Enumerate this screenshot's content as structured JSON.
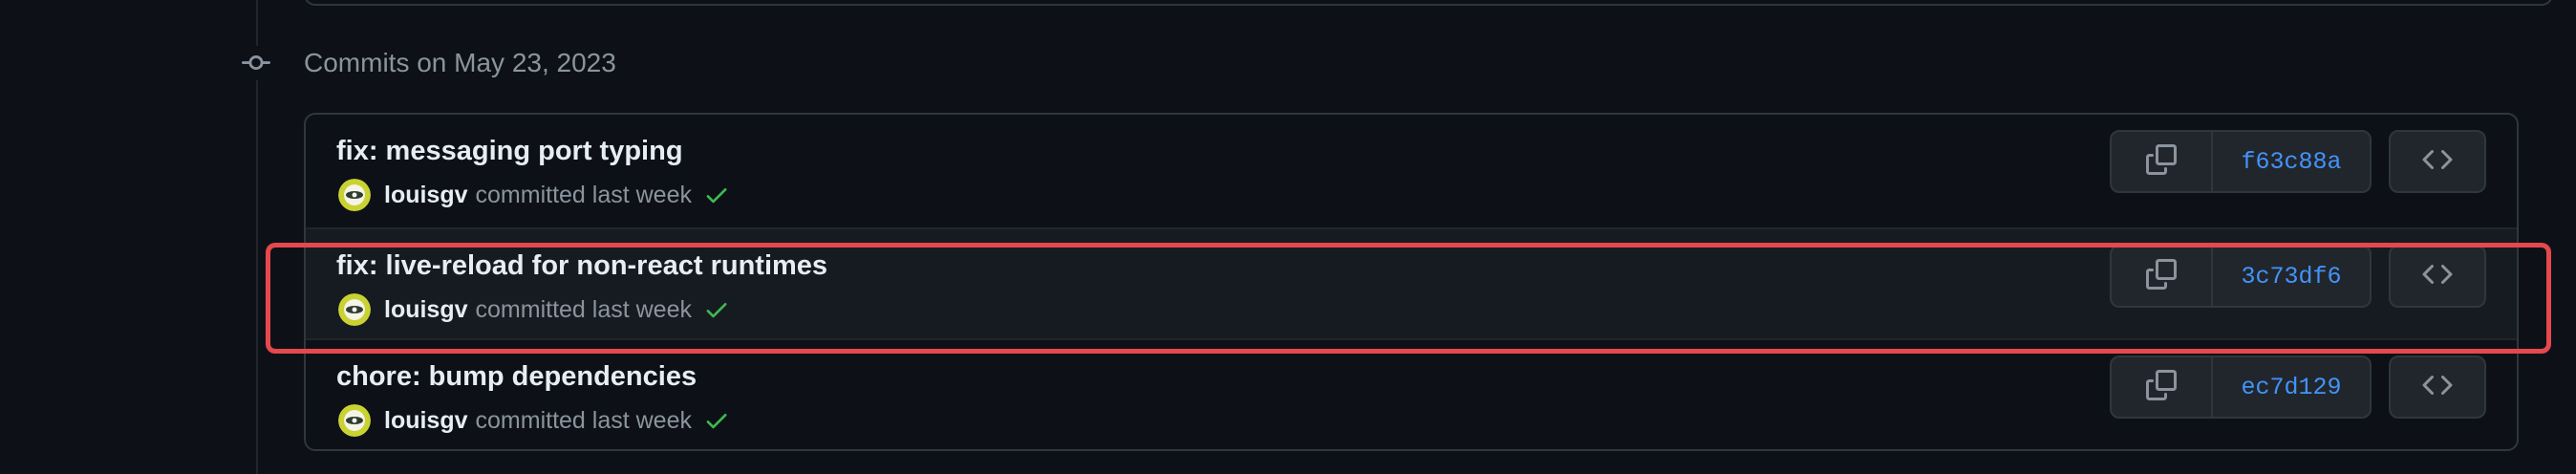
{
  "group": {
    "title": "Commits on May 23, 2023"
  },
  "commits": [
    {
      "title": "fix: messaging port typing",
      "author": "louisgv",
      "meta": "committed last week",
      "sha": "f63c88a"
    },
    {
      "title": "fix: live-reload for non-react runtimes",
      "author": "louisgv",
      "meta": "committed last week",
      "sha": "3c73df6"
    },
    {
      "title": "chore: bump dependencies",
      "author": "louisgv",
      "meta": "committed last week",
      "sha": "ec7d129"
    }
  ],
  "icons": {
    "commit_node": "git-commit-icon",
    "copy": "copy-icon",
    "browse": "code-icon",
    "status": "check-icon"
  },
  "colors": {
    "background": "#0d1117",
    "link": "#4493f8",
    "success": "#3fb950",
    "highlight": "#e5484d",
    "muted": "#8b949e"
  }
}
